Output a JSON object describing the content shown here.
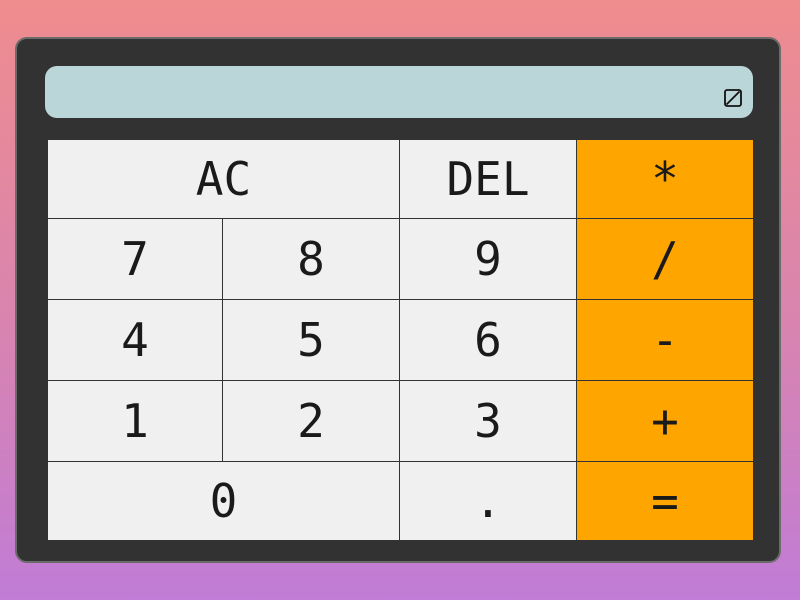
{
  "display": {
    "value": "",
    "icon": "clear-display-icon"
  },
  "keys": {
    "ac": "AC",
    "del": "DEL",
    "multiply": "*",
    "seven": "7",
    "eight": "8",
    "nine": "9",
    "divide": "/",
    "four": "4",
    "five": "5",
    "six": "6",
    "subtract": "-",
    "one": "1",
    "two": "2",
    "three": "3",
    "add": "+",
    "zero": "0",
    "decimal": ".",
    "equals": "="
  },
  "colors": {
    "operator": "#FFA500",
    "key": "#F0F0F0",
    "display": "#BBD6D8",
    "body": "#323232"
  }
}
